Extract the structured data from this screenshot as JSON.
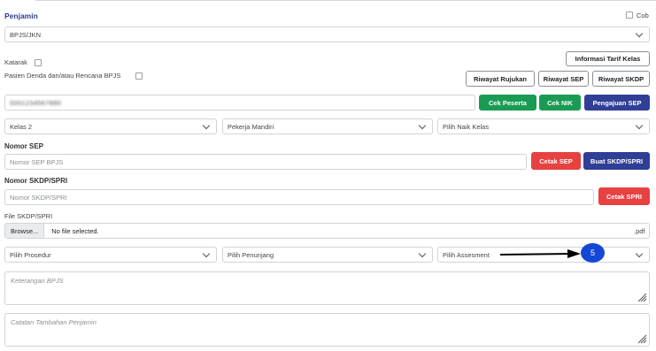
{
  "penjamin": {
    "title": "Penjamin",
    "cob_label": "Cob",
    "select_value": "BPJS/JKN"
  },
  "flags": {
    "katarak_label": "Katarak",
    "denda_label": "Pasien Denda dan/atau Rencana BPJS"
  },
  "buttons": {
    "informasi_tarif": "Informasi Tarif Kelas",
    "riwayat_rujukan": "Riwayat Rujukan",
    "riwayat_sep": "Riwayat SEP",
    "riwayat_skdp": "Riwayat SKDP",
    "cek_peserta": "Cek Peserta",
    "cek_nik": "Cek NIK",
    "pengajuan_sep": "Pengajuan SEP",
    "cetak_sep": "Cetak SEP",
    "buat_skdp": "Buat SKDP/SPRI",
    "cetak_spri": "Cetak SPRI"
  },
  "card_number": "0001234567890",
  "selects_row1": {
    "kelas": "Kelas 2",
    "pekerjaan": "Pekerja Mandiri",
    "naik_kelas": "Pilih Naik Kelas"
  },
  "nomor_sep": {
    "label": "Nomor SEP",
    "placeholder": "Nomor SEP BPJS"
  },
  "nomor_skdp": {
    "label": "Nomor SKDP/SPRI",
    "placeholder": "Nomor SKDP/SPRI"
  },
  "file_skdp": {
    "label": "File SKDP/SPRI",
    "browse": "Browse...",
    "status": "No file selected.",
    "ext": ".pdf"
  },
  "selects_row2": {
    "prosedur": "Pilih Prosedur",
    "penunjang": "Pilih Penunjang",
    "assesment": "Pilih Assesment"
  },
  "annotation": {
    "badge": "5",
    "badge_color": "#1547d6"
  },
  "keterangan_placeholder": "Keterangan BPJS",
  "catatan_placeholder": "Catatan Tambahan Penjamin",
  "colors": {
    "primary_blue": "#2f3f96",
    "green": "#1a9b53",
    "red": "#e84141"
  }
}
